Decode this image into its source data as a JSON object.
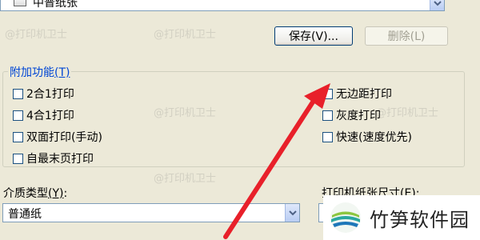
{
  "paper_combo": {
    "value": "中普纸张"
  },
  "buttons": {
    "save": "保存(V)...",
    "delete": "删除(L)"
  },
  "additional": {
    "title": "附加功能",
    "title_key": "(T)",
    "left": [
      "2合1打印",
      "4合1打印",
      "双面打印(手动)",
      "自最末页打印"
    ],
    "right": [
      "无边距打印",
      "灰度打印",
      "快速(速度优先)"
    ]
  },
  "media": {
    "label": "介质类型",
    "key": "(Y)",
    "colon": ":",
    "value": "普通纸"
  },
  "paper_size": {
    "label": "打印机纸张尺寸",
    "key": "(E)",
    "colon": ":"
  },
  "watermark": {
    "text": "@打印机卫士"
  },
  "logo": {
    "text": "竹笋软件园"
  }
}
